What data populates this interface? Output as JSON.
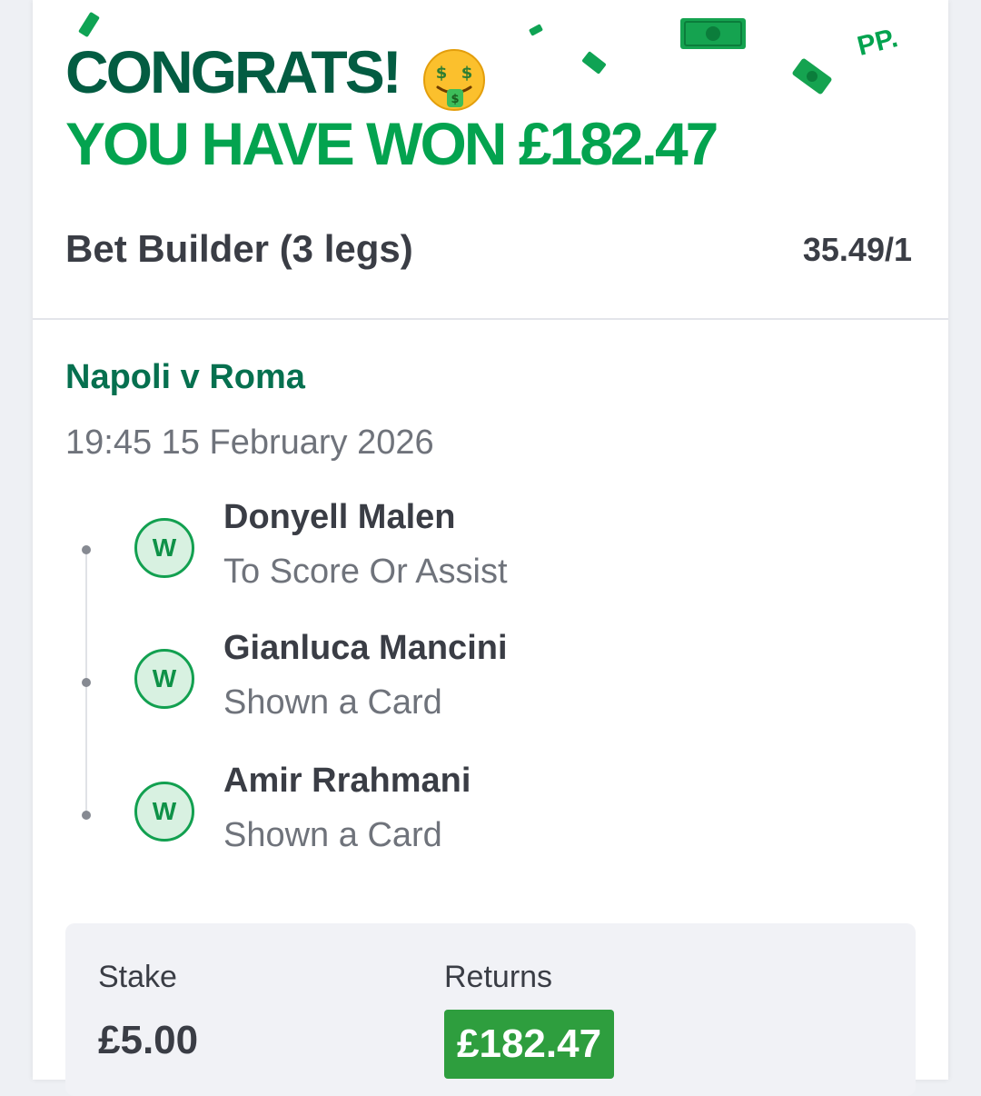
{
  "header": {
    "congrats_text": "CONGRATS!",
    "emoji_icon": "money-mouth-face-icon",
    "won_text": "YOU HAVE WON £182.47",
    "brand_logo": "PP."
  },
  "bet": {
    "title": "Bet Builder (3 legs)",
    "odds": "35.49/1"
  },
  "match": {
    "title": "Napoli v Roma",
    "datetime": "19:45 15 February 2026"
  },
  "legs": [
    {
      "result": "W",
      "selection": "Donyell Malen",
      "market": "To Score Or Assist"
    },
    {
      "result": "W",
      "selection": "Gianluca Mancini",
      "market": "Shown a Card"
    },
    {
      "result": "W",
      "selection": "Amir Rrahmani",
      "market": "Shown a Card"
    }
  ],
  "summary": {
    "stake_label": "Stake",
    "stake_value": "£5.00",
    "returns_label": "Returns",
    "returns_value": "£182.47"
  },
  "colors": {
    "congrats_dark_green": "#035c42",
    "won_green": "#03a34f",
    "match_title_green": "#06704f",
    "badge_green": "#12a050",
    "returns_bg": "#2e9e3e",
    "text_dark": "#3a3d45",
    "text_muted": "#6f737b"
  }
}
